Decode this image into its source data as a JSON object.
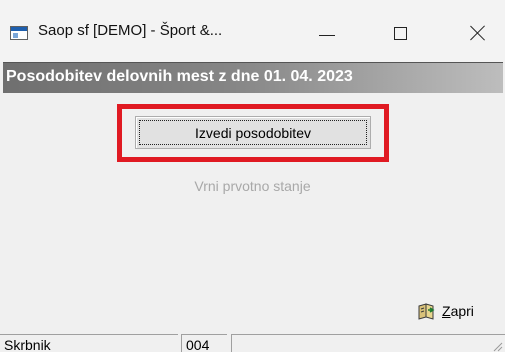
{
  "window": {
    "title": "Saop sf [DEMO] - Šport &...",
    "icon": "app-window-icon",
    "controls": {
      "minimize": "minimize-icon",
      "maximize": "maximize-icon",
      "close": "close-icon"
    }
  },
  "header": {
    "text": "Posodobitev delovnih mest z dne 01. 04. 2023"
  },
  "actions": {
    "primary_label": "Izvedi posodobitev",
    "secondary_label": "Vrni prvotno stanje",
    "highlight_color": "#e01a22"
  },
  "footer": {
    "close_prefix": "Z",
    "close_rest": "apri",
    "close_icon": "book-exit-icon"
  },
  "statusbar": {
    "user": "Skrbnik",
    "code": "004",
    "extra": ""
  },
  "colors": {
    "header_band": "#858585",
    "disabled_text": "#a8a8a8"
  }
}
